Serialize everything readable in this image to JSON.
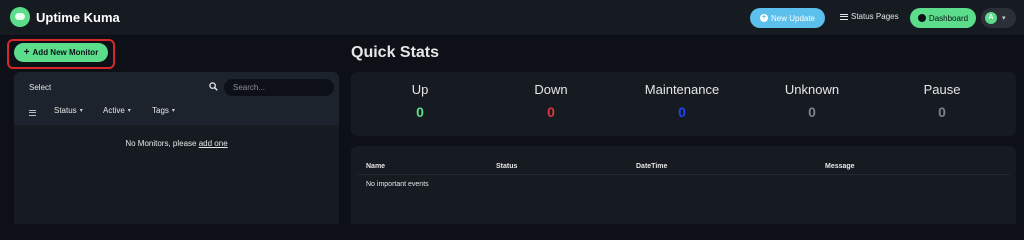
{
  "app": {
    "name": "Uptime Kuma"
  },
  "header": {
    "new_update_label": "New Update",
    "status_pages_label": "Status Pages",
    "dashboard_label": "Dashboard",
    "avatar_initial": "A"
  },
  "sidebar": {
    "add_monitor_label": "Add New Monitor",
    "select_label": "Select",
    "search": {
      "placeholder": "Search..."
    },
    "filters": [
      {
        "label": "Status"
      },
      {
        "label": "Active"
      },
      {
        "label": "Tags"
      }
    ],
    "empty_text": "No Monitors, please",
    "empty_link": "add one"
  },
  "quick_stats": {
    "title": "Quick Stats",
    "items": [
      {
        "label": "Up",
        "value": "0",
        "color": "#5cdd8b"
      },
      {
        "label": "Down",
        "value": "0",
        "color": "#dc3545"
      },
      {
        "label": "Maintenance",
        "value": "0",
        "color": "#1747f5"
      },
      {
        "label": "Unknown",
        "value": "0",
        "color": "#7f8287"
      },
      {
        "label": "Pause",
        "value": "0",
        "color": "#7f8287"
      }
    ]
  },
  "events": {
    "columns": [
      "Name",
      "Status",
      "DateTime",
      "Message"
    ],
    "empty_text": "No important events"
  },
  "colors": {
    "accent_green": "#5cdd8b",
    "accent_blue": "#5bc0eb",
    "highlight_red": "#d62828",
    "background": "#0d1117",
    "panel": "#161b22"
  },
  "icons": [
    "app-logo-icon",
    "plus-circle-icon",
    "menu-lines-icon",
    "gauge-icon",
    "chevron-down-icon",
    "plus-icon",
    "search-icon",
    "filter-icon"
  ]
}
